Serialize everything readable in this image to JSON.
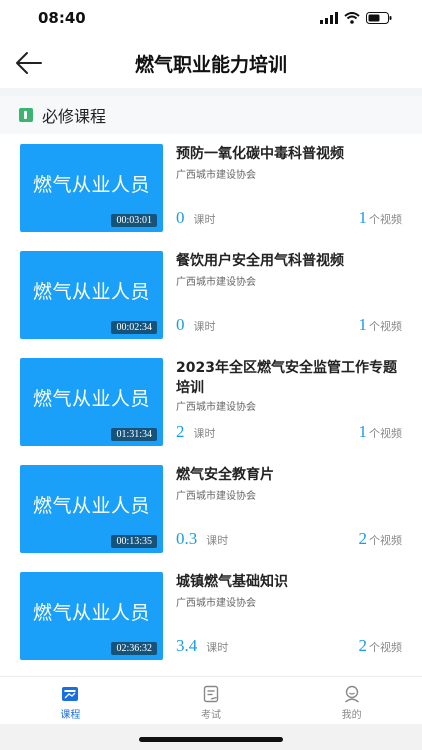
{
  "status_bar": {
    "time": "08:40"
  },
  "nav": {
    "title": "燃气职业能力培训"
  },
  "section": {
    "title": "必修课程"
  },
  "thumbnail_label": "燃气从业人员",
  "hours_unit": "课时",
  "videos_unit": "个视频",
  "courses": [
    {
      "title": "预防一氧化碳中毒科普视频",
      "org": "广西城市建设协会",
      "duration": "00:03:01",
      "hours": "0",
      "videos": "1"
    },
    {
      "title": "餐饮用户安全用气科普视频",
      "org": "广西城市建设协会",
      "duration": "00:02:34",
      "hours": "0",
      "videos": "1"
    },
    {
      "title": "2023年全区燃气安全监管工作专题培训",
      "org": "广西城市建设协会",
      "duration": "01:31:34",
      "hours": "2",
      "videos": "1"
    },
    {
      "title": "燃气安全教育片",
      "org": "广西城市建设协会",
      "duration": "00:13:35",
      "hours": "0.3",
      "videos": "2"
    },
    {
      "title": "城镇燃气基础知识",
      "org": "广西城市建设协会",
      "duration": "02:36:32",
      "hours": "3.4",
      "videos": "2"
    }
  ],
  "tabs": [
    {
      "label": "课程",
      "icon": "course-icon",
      "active": true
    },
    {
      "label": "考试",
      "icon": "exam-icon",
      "active": false
    },
    {
      "label": "我的",
      "icon": "profile-icon",
      "active": false
    }
  ],
  "colors": {
    "thumbnail": "#1aa0f8",
    "accent": "#1a9be6",
    "tab_active": "#1a6fe0"
  }
}
